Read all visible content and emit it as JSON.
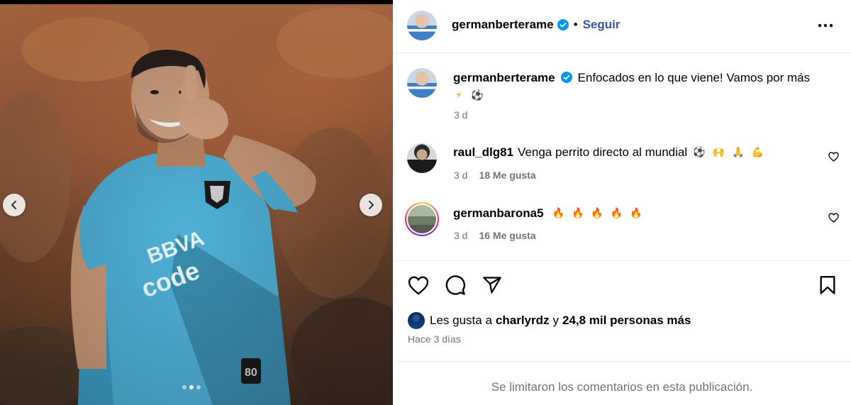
{
  "post": {
    "author": "germanberterame",
    "follow_label": "Seguir",
    "separator": "•",
    "caption": "Enfocados en lo que viene! Vamos por más",
    "caption_emojis": [
      "⚡",
      "⚽"
    ],
    "caption_time": "3 d",
    "more_icon": "more-horizontal-icon",
    "verified_icon": "verified-badge-icon"
  },
  "media": {
    "carousel_dots": 3,
    "active_dot": 1,
    "prev_icon": "chevron-left-icon",
    "next_icon": "chevron-right-icon"
  },
  "comments": [
    {
      "user": "raul_dlg81",
      "text": "Venga perrito directo al mundial",
      "emojis": [
        "⚽",
        "🙌",
        "🙏",
        "💪"
      ],
      "time": "3 d",
      "likes": "18 Me gusta"
    },
    {
      "user": "germanbarona5",
      "text": "",
      "emojis": [
        "🔥",
        "🔥",
        "🔥",
        "🔥",
        "🔥"
      ],
      "time": "3 d",
      "likes": "16 Me gusta"
    }
  ],
  "actions": {
    "like_icon": "heart-icon",
    "comment_icon": "comment-icon",
    "share_icon": "share-icon",
    "save_icon": "bookmark-icon"
  },
  "likes_summary": {
    "prefix": "Les gusta a",
    "user": "charlyrdz",
    "middle": "y",
    "count_text": "24,8 mil personas más"
  },
  "posted_ago": "Hace 3 días",
  "comments_limited": "Se limitaron los comentarios en esta publicación.",
  "colors": {
    "link": "#3554a3",
    "verified": "#0095f6",
    "muted": "#737373",
    "divider": "#efefef"
  }
}
